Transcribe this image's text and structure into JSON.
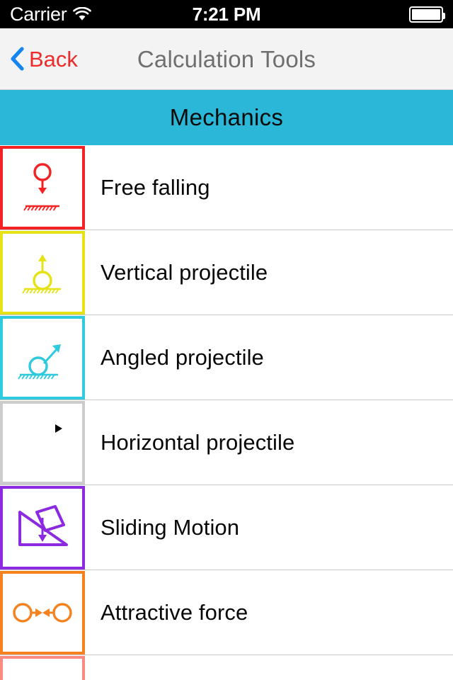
{
  "status_bar": {
    "carrier": "Carrier",
    "wifi_icon": "wifi-icon",
    "time": "7:21 PM",
    "battery_icon": "battery-full-icon",
    "background": "#000000",
    "text_color": "#ffffff"
  },
  "nav_bar": {
    "back_label": "Back",
    "back_icon": "chevron-left-icon",
    "back_color": "#ee2b2b",
    "chevron_color": "#1484f0",
    "title": "Calculation Tools",
    "title_color": "#6f6f6f",
    "background": "#f3f3f3"
  },
  "section": {
    "title": "Mechanics",
    "background": "#2bb8d8",
    "text_color": "#0a0a0a"
  },
  "list": {
    "rows": [
      {
        "label": "Free falling",
        "icon_name": "free-falling-icon",
        "color": "#f42222",
        "partial": false
      },
      {
        "label": "Vertical projectile",
        "icon_name": "vertical-projectile-icon",
        "color": "#e5e218",
        "partial": false
      },
      {
        "label": "Angled projectile",
        "icon_name": "angled-projectile-icon",
        "color": "#2fcadd",
        "partial": false
      },
      {
        "label": "Horizontal projectile",
        "icon_name": "horizontal-projectile-icon",
        "color": "#5bd martyr",
        "partial": false
      },
      {
        "label": "Sliding Motion",
        "icon_name": "sliding-motion-icon",
        "color": "#8b2ae0",
        "partial": false
      },
      {
        "label": "Attractive force",
        "icon_name": "attractive-force-icon",
        "color": "#f5821f",
        "partial": false
      },
      {
        "label": "",
        "icon_name": "repulsive-force-icon",
        "color": "#f98b82",
        "partial": true
      }
    ]
  }
}
